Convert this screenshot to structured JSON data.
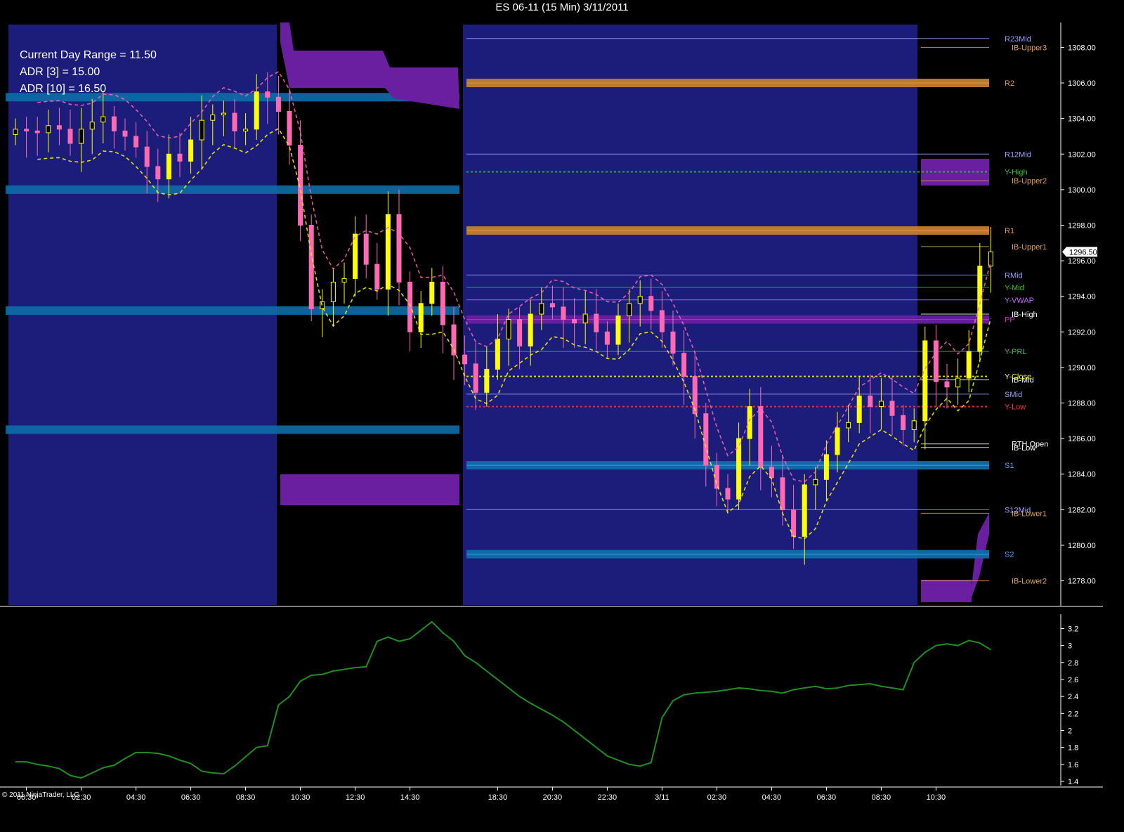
{
  "header": {
    "title": "ES 06-11 (15 Min)  3/11/2011"
  },
  "annotations": {
    "range": "Current Day Range = 11.50",
    "adr3": "ADR [3] = 15.00",
    "adr10": "ADR [10] = 16.50"
  },
  "footer": {
    "copyright": "© 2011 NinjaTrader, LLC"
  },
  "colors": {
    "background": "#000000",
    "session_shade": "#1c1c7a",
    "bull_candle": "#ffff00",
    "bear_candle": "#ff69b4",
    "value_area_band": "#0e6ea8",
    "pivot_band_orange": "#c47f2c",
    "pivot_band_purple": "#6a1ea0",
    "indicator_line": "#1f8f1f",
    "axis_text": "#ffffff"
  },
  "chart_data": [
    {
      "type": "line",
      "panel": "price",
      "instrument": "ES 06-11",
      "interval": "15 Min",
      "ylim": [
        1276.6,
        1309.4
      ],
      "y_ticks": [
        1278,
        1280,
        1282,
        1284,
        1286,
        1288,
        1290,
        1292,
        1294,
        1296,
        1298,
        1300,
        1302,
        1304,
        1306,
        1308
      ],
      "y_tick_labels": [
        "1278.00",
        "1280.00",
        "1282.00",
        "1284.00",
        "1286.00",
        "1288.00",
        "1290.00",
        "1292.00",
        "1294.00",
        "1296.00",
        "1298.00",
        "1300.00",
        "1302.00",
        "1304.00",
        "1306.00",
        "1308.00"
      ],
      "x_tick_labels": [
        "00:30",
        "02:30",
        "04:30",
        "06:30",
        "08:30",
        "10:30",
        "12:30",
        "14:30",
        "18:30",
        "20:30",
        "22:30",
        "3/11",
        "02:30",
        "04:30",
        "06:30",
        "08:30",
        "10:30"
      ],
      "x_tick_positions": [
        1,
        6,
        11,
        16,
        21,
        26,
        31,
        36,
        44,
        49,
        54,
        59,
        64,
        69,
        74,
        79,
        84
      ],
      "bar_count": 90,
      "last_price_label": "1296.50",
      "series": [
        {
          "name": "",
          "values": [
            1303.4,
            1303.3,
            1303.2,
            1303.6,
            1303.4,
            1302.6,
            1303.4,
            1303.8,
            1304.1,
            1303.3,
            1303.0,
            1302.4,
            1301.3,
            1300.6,
            1302.0,
            1301.6,
            1302.8,
            1303.9,
            1304.2,
            1304.3,
            1303.3,
            1303.4,
            1305.5,
            1305.2,
            1304.4,
            1302.5,
            1298.0,
            1293.3,
            1293.7,
            1294.8,
            1295.0,
            1297.5,
            1295.8,
            1294.4,
            1298.6,
            1294.8,
            1292.0,
            1293.6,
            1294.8,
            1292.4,
            1290.7,
            1290.2,
            1288.6,
            1289.9,
            1291.6,
            1292.7,
            1291.2,
            1293.0,
            1293.6,
            1293.4,
            1292.7,
            1292.5,
            1293.0,
            1292.0,
            1291.3,
            1292.9,
            1293.6,
            1294.0,
            1293.2,
            1292.0,
            1290.8,
            1289.5,
            1287.4,
            1284.5,
            1283.2,
            1282.6,
            1286.0,
            1287.8,
            1284.4,
            1283.8,
            1282.0,
            1280.5,
            1283.4,
            1283.7,
            1285.1,
            1286.6,
            1286.9,
            1288.4,
            1287.8,
            1288.1,
            1287.3,
            1286.5,
            1287.0,
            1291.5,
            1289.2,
            1288.9,
            1289.4,
            1290.9,
            1295.7,
            1296.5
          ]
        }
      ],
      "horizontal_levels": [
        {
          "name": "R23Mid",
          "value": 1308.5,
          "color": "#9aa0ff"
        },
        {
          "name": "IB-Upper3",
          "value": 1308.0,
          "color": "#e0a050"
        },
        {
          "name": "R2",
          "value": 1306.0,
          "color": "#e0a050"
        },
        {
          "name": "R12Mid",
          "value": 1302.0,
          "color": "#9aa0ff"
        },
        {
          "name": "Y-High",
          "value": 1301.0,
          "color": "#22cc22"
        },
        {
          "name": "IB-Upper2",
          "value": 1300.5,
          "color": "#e0a050"
        },
        {
          "name": "R1",
          "value": 1297.7,
          "color": "#e0a050"
        },
        {
          "name": "IB-Upper1",
          "value": 1296.8,
          "color": "#e0a050"
        },
        {
          "name": "RMid",
          "value": 1295.2,
          "color": "#9aa0ff"
        },
        {
          "name": "Y-Mid",
          "value": 1294.5,
          "color": "#22cc22"
        },
        {
          "name": "Y-VWAP",
          "value": 1293.8,
          "color": "#cc66ff"
        },
        {
          "name": "IB-High",
          "value": 1293.0,
          "color": "#ffffff"
        },
        {
          "name": "PP",
          "value": 1292.7,
          "color": "#cc33cc"
        },
        {
          "name": "Y-PRL",
          "value": 1290.9,
          "color": "#22cc22"
        },
        {
          "name": "Y-Close",
          "value": 1289.5,
          "color": "#ffff00"
        },
        {
          "name": "IB-Mid",
          "value": 1289.3,
          "color": "#ffffff"
        },
        {
          "name": "SMid",
          "value": 1288.5,
          "color": "#9aa0ff"
        },
        {
          "name": "Y-Low",
          "value": 1287.8,
          "color": "#ff3333"
        },
        {
          "name": "RTH Open",
          "value": 1285.7,
          "color": "#ffffff"
        },
        {
          "name": "IB-Low",
          "value": 1285.5,
          "color": "#ffffff"
        },
        {
          "name": "S1",
          "value": 1284.5,
          "color": "#4aa8ff"
        },
        {
          "name": "S12Mid",
          "value": 1282.0,
          "color": "#9aa0ff"
        },
        {
          "name": "IB-Lower1",
          "value": 1281.8,
          "color": "#e0a050"
        },
        {
          "name": "S2",
          "value": 1279.5,
          "color": "#4aa8ff"
        },
        {
          "name": "IB-Lower2",
          "value": 1278.0,
          "color": "#e0a050"
        }
      ]
    },
    {
      "type": "line",
      "panel": "indicator",
      "ylim": [
        1.35,
        3.32
      ],
      "y_ticks": [
        1.4,
        1.6,
        1.8,
        2,
        2.2,
        2.4,
        2.6,
        2.8,
        3,
        3.2
      ],
      "y_tick_labels": [
        "1.4",
        "1.6",
        "1.8",
        "2",
        "2.2",
        "2.4",
        "2.6",
        "2.8",
        "3",
        "3.2"
      ],
      "series": [
        {
          "name": "",
          "values": [
            1.63,
            1.63,
            1.6,
            1.58,
            1.55,
            1.47,
            1.44,
            1.5,
            1.56,
            1.59,
            1.67,
            1.74,
            1.74,
            1.73,
            1.7,
            1.65,
            1.61,
            1.52,
            1.5,
            1.49,
            1.58,
            1.69,
            1.8,
            1.82,
            2.3,
            2.4,
            2.58,
            2.65,
            2.66,
            2.7,
            2.72,
            2.74,
            2.75,
            3.05,
            3.1,
            3.05,
            3.08,
            3.18,
            3.28,
            3.15,
            3.05,
            2.88,
            2.8,
            2.7,
            2.6,
            2.5,
            2.4,
            2.32,
            2.25,
            2.18,
            2.1,
            2.0,
            1.9,
            1.8,
            1.7,
            1.65,
            1.6,
            1.58,
            1.62,
            2.15,
            2.35,
            2.42,
            2.44,
            2.45,
            2.46,
            2.48,
            2.5,
            2.49,
            2.47,
            2.46,
            2.44,
            2.48,
            2.5,
            2.52,
            2.49,
            2.5,
            2.53,
            2.54,
            2.55,
            2.52,
            2.5,
            2.48,
            2.8,
            2.92,
            3.0,
            3.02,
            3.0,
            3.06,
            3.03,
            2.95
          ]
        }
      ]
    }
  ]
}
